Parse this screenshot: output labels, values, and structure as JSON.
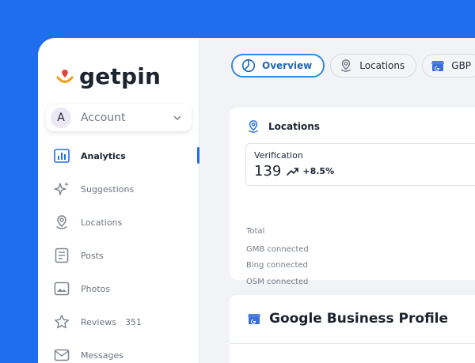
{
  "colors": {
    "page_background": "#1f6ef0",
    "accent": "#1f6ef0",
    "tab_active": "#3a87d6",
    "logo_pin_red": "#e2453c",
    "logo_smile_orange": "#f4a21d"
  },
  "brand": {
    "name": "getpin"
  },
  "account": {
    "avatar_letter": "A",
    "label": "Account",
    "icon": "chevron-down-icon"
  },
  "sidebar": {
    "items": [
      {
        "label": "Analytics",
        "icon": "bar-chart-icon",
        "active": true
      },
      {
        "label": "Suggestions",
        "icon": "sparkle-icon"
      },
      {
        "label": "Locations",
        "icon": "map-pin-icon"
      },
      {
        "label": "Posts",
        "icon": "document-icon"
      },
      {
        "label": "Photos",
        "icon": "image-icon"
      },
      {
        "label": "Reviews",
        "icon": "star-icon",
        "count": "351"
      },
      {
        "label": "Messages",
        "icon": "mail-icon"
      }
    ]
  },
  "tabs": [
    {
      "label": "Overview",
      "icon": "pie-chart-icon",
      "active": true
    },
    {
      "label": "Locations",
      "icon": "map-pin-icon"
    },
    {
      "label": "GBP",
      "icon": "store-icon"
    }
  ],
  "locations_card": {
    "title": "Locations",
    "icon": "map-pin-icon",
    "verification": {
      "label": "Verification",
      "value": "139",
      "delta": "+8.5%",
      "icon": "trend-up-icon"
    },
    "stats": [
      "Total",
      "GMB connected",
      "Bing connected",
      "OSM connected"
    ]
  },
  "gbp_card": {
    "title": "Google Business Profile",
    "icon": "google-business-icon"
  }
}
